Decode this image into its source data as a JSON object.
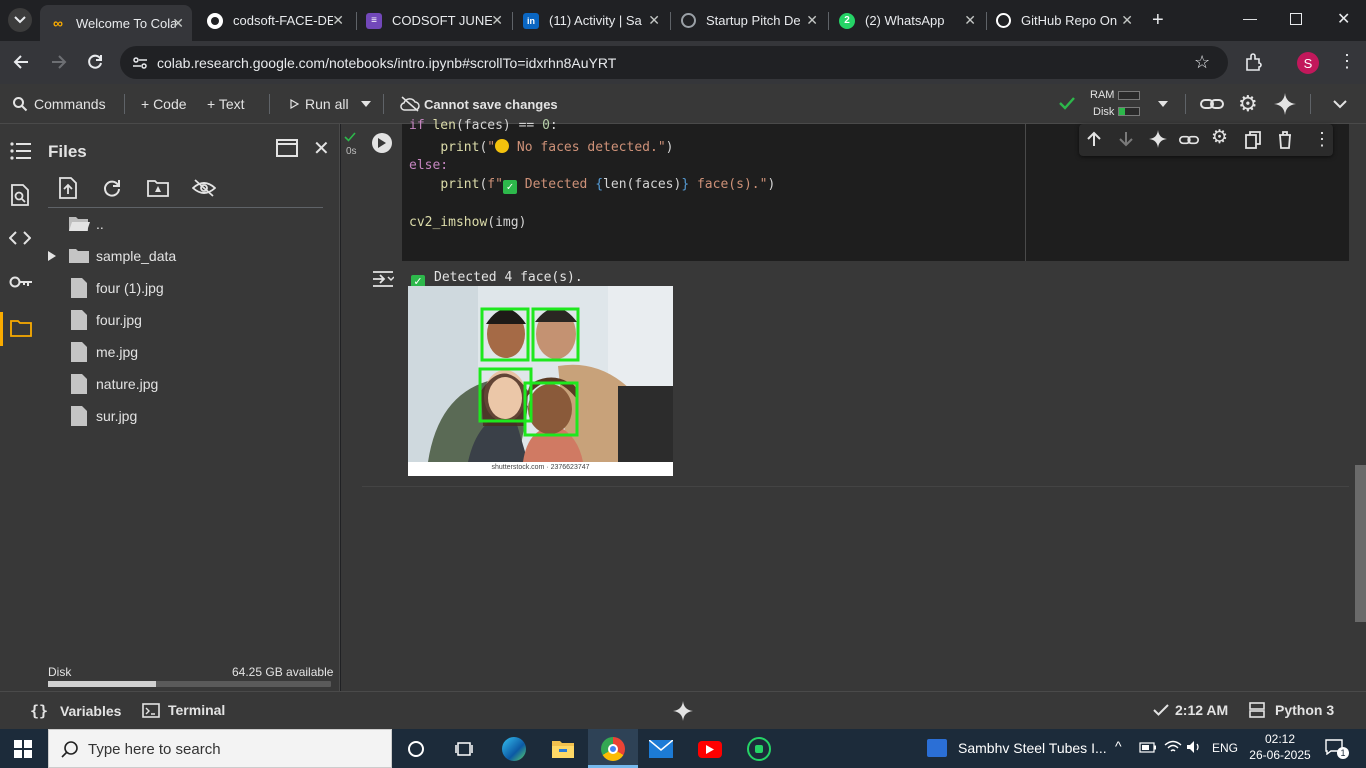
{
  "browser": {
    "tabs": [
      {
        "title": "Welcome To Cola",
        "favicon": "colab-icon",
        "color": "#f9ab00",
        "active": true
      },
      {
        "title": "codsoft-FACE-DE",
        "favicon": "github-icon",
        "color": "#ffffff",
        "active": false
      },
      {
        "title": "CODSOFT JUNE",
        "favicon": "forms-icon",
        "color": "#7248b9",
        "active": false
      },
      {
        "title": "(11) Activity | Sa",
        "favicon": "linkedin-icon",
        "color": "#0a66c2",
        "active": false
      },
      {
        "title": "Startup Pitch De",
        "favicon": "web-icon",
        "color": "#9aa0a6",
        "active": false
      },
      {
        "title": "(2) WhatsApp",
        "favicon": "whatsapp-icon",
        "color": "#25d366",
        "active": false
      },
      {
        "title": "GitHub Repo On",
        "favicon": "openai-icon",
        "color": "#ffffff",
        "active": false
      }
    ],
    "url": "colab.research.google.com/notebooks/intro.ipynb#scrollTo=idxrhn8AuYRT",
    "profile_initial": "S"
  },
  "toolbar": {
    "commands": "Commands",
    "code": "+ Code",
    "text": "+ Text",
    "run_all": "Run all",
    "cannot_save": "Cannot save changes",
    "ram_label": "RAM",
    "disk_label": "Disk"
  },
  "files_panel": {
    "title": "Files",
    "items": [
      {
        "name": "..",
        "kind": "folder-open"
      },
      {
        "name": "sample_data",
        "kind": "folder"
      },
      {
        "name": "four (1).jpg",
        "kind": "file"
      },
      {
        "name": "four.jpg",
        "kind": "file"
      },
      {
        "name": "me.jpg",
        "kind": "file"
      },
      {
        "name": "nature.jpg",
        "kind": "file"
      },
      {
        "name": "sur.jpg",
        "kind": "file"
      }
    ],
    "disk_label": "Disk",
    "disk_available": "64.25 GB available",
    "disk_used_fraction": 0.38
  },
  "cell": {
    "exec_time": "0s",
    "lines": {
      "l1_a": "if ",
      "l1_b": "len",
      "l1_c": "(faces) == ",
      "l1_d": "0",
      "l1_e": ":",
      "l2_a": "    ",
      "l2_b": "print",
      "l2_c": "(",
      "l2_d": "\"",
      "l2_e": " No faces detected.\"",
      "l2_f": ")",
      "l3": "else:",
      "l4_a": "    ",
      "l4_b": "print",
      "l4_c": "(",
      "l4_d": "f\"",
      "l4_e": " Detected ",
      "l4_f": "{",
      "l4_g": "len(faces)",
      "l4_h": "}",
      "l4_i": " face(s).\"",
      "l4_j": ")",
      "l6_a": "cv2_imshow",
      "l6_b": "(img)"
    },
    "output_text": "Detected 4 face(s).",
    "image_caption": "shutterstock.com · 2376623747"
  },
  "statusbar": {
    "variables": "Variables",
    "terminal": "Terminal",
    "time": "2:12 AM",
    "runtime": "Python 3"
  },
  "taskbar": {
    "search_placeholder": "Type here to search",
    "notification": "Sambhv Steel Tubes I...",
    "lang": "ENG",
    "clock_time": "02:12",
    "clock_date": "26-06-2025",
    "notif_count": "1"
  }
}
